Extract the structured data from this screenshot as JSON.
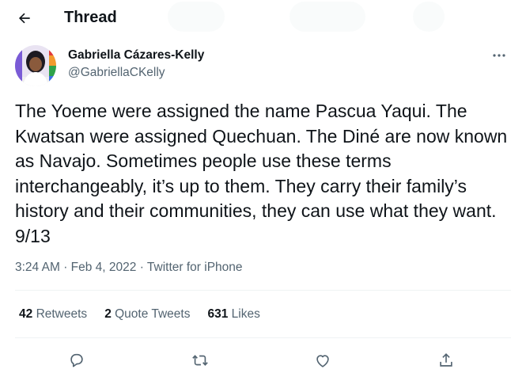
{
  "header": {
    "title": "Thread",
    "back_icon": "arrow-left-icon"
  },
  "author": {
    "name": "Gabriella Cázares-Kelly",
    "handle": "@GabriellaCKelly"
  },
  "tweet": {
    "text": "The Yoeme were assigned the name Pascua Yaqui. The Kwatsan were assigned Quechuan. The Diné are now known as Navajo. Sometimes people use these terms interchangeably, it’s up to them. They carry their family’s history and their communities, they can use what they want. 9/13",
    "time": "3:24 AM",
    "date": "Feb 4, 2022",
    "source": "Twitter for iPhone"
  },
  "stats": {
    "retweets_count": "42",
    "retweets_label": "Retweets",
    "quotes_count": "2",
    "quotes_label": "Quote Tweets",
    "likes_count": "631",
    "likes_label": "Likes"
  },
  "actions": [
    "reply-icon",
    "retweet-icon",
    "like-icon",
    "share-icon"
  ],
  "colors": {
    "text": "#0f1419",
    "secondary": "#536471",
    "divider": "#eff3f4"
  }
}
